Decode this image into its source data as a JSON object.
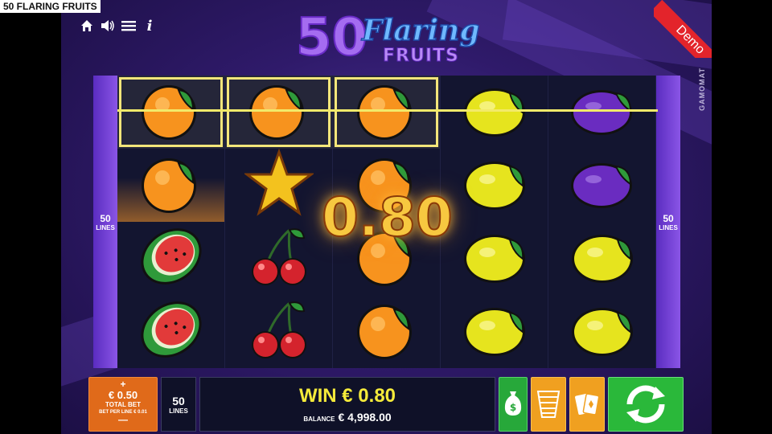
{
  "window": {
    "title": "50 FLARING FRUITS"
  },
  "toolbar": {
    "icons": [
      "home-icon",
      "sound-icon",
      "menu-icon",
      "info-icon"
    ]
  },
  "logo": {
    "number": "50",
    "word1": "Flaring",
    "word2": "FRUITS"
  },
  "demo_badge": "Demo",
  "provider": "GAMOMAT",
  "side_lines": {
    "count": "50",
    "label": "LINES"
  },
  "reels": {
    "rows": [
      [
        "orange",
        "orange",
        "orange",
        "lemon",
        "plum"
      ],
      [
        "orange",
        "star",
        "orange",
        "lemon",
        "plum"
      ],
      [
        "watermelon",
        "cherry",
        "orange",
        "lemon",
        "lemon"
      ],
      [
        "watermelon",
        "cherry",
        "orange",
        "lemon",
        "lemon"
      ]
    ],
    "winning_cells": [
      [
        0,
        0
      ],
      [
        0,
        1
      ],
      [
        0,
        2
      ],
      [
        1,
        0
      ]
    ]
  },
  "win_popup": "0.80",
  "bottom": {
    "bet": {
      "plus": "+",
      "value": "€ 0.50",
      "label": "TOTAL BET",
      "per_line": "BET PER LINE € 0.01",
      "minus": "—"
    },
    "lines": {
      "count": "50",
      "label": "LINES"
    },
    "win": {
      "text": "WIN € 0.80"
    },
    "balance": {
      "label": "BALANCE",
      "value": "€ 4,998.00"
    }
  },
  "colors": {
    "accent_orange": "#e06a1a",
    "accent_green": "#2ab83a",
    "win_yellow": "#f4ea3a",
    "payline": "#f2ea6a"
  }
}
